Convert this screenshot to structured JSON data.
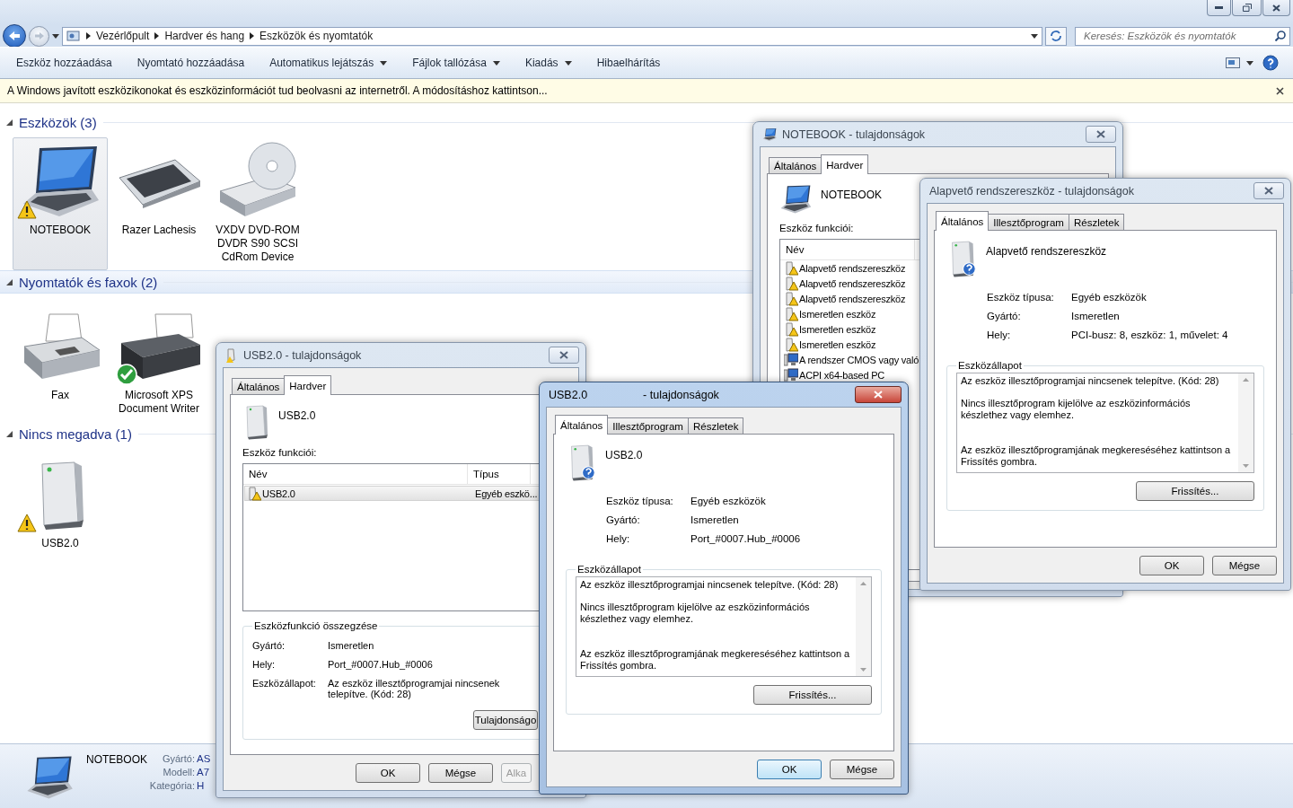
{
  "address_bar": {
    "path": [
      "Vezérlőpult",
      "Hardver és hang",
      "Eszközök és nyomtatók"
    ]
  },
  "search": {
    "placeholder": "Keresés: Eszközök és nyomtatók"
  },
  "toolbar": [
    {
      "label": "Eszköz hozzáadása",
      "dropdown": false
    },
    {
      "label": "Nyomtató hozzáadása",
      "dropdown": false
    },
    {
      "label": "Automatikus lejátszás",
      "dropdown": true
    },
    {
      "label": "Fájlok tallózása",
      "dropdown": true
    },
    {
      "label": "Kiadás",
      "dropdown": true
    },
    {
      "label": "Hibaelhárítás",
      "dropdown": false
    }
  ],
  "info_bar": {
    "text": "A Windows javított eszközikonokat és eszközinformációt tud beolvasni az internetről. A módosításhoz kattintson..."
  },
  "groups": [
    {
      "title": "Eszközök (3)",
      "expanded": true,
      "hovered": false,
      "items": [
        {
          "label": "NOTEBOOK",
          "kind": "laptop",
          "warning": true,
          "default": false,
          "selected": true
        },
        {
          "label": "Razer Lachesis",
          "kind": "keyboard",
          "warning": false,
          "default": false,
          "selected": false
        },
        {
          "label": "VXDV DVD-ROM DVDR S90 SCSI CdRom Device",
          "kind": "drive",
          "warning": false,
          "default": false,
          "selected": false
        }
      ]
    },
    {
      "title": "Nyomtatók és faxok (2)",
      "expanded": true,
      "hovered": true,
      "items": [
        {
          "label": "Fax",
          "kind": "fax",
          "warning": false,
          "default": false,
          "selected": false
        },
        {
          "label": "Microsoft XPS Document Writer",
          "kind": "printer",
          "warning": false,
          "default": true,
          "selected": false
        }
      ]
    },
    {
      "title": "Nincs megadva (1)",
      "expanded": true,
      "hovered": false,
      "items": [
        {
          "label": "USB2.0",
          "kind": "tower",
          "warning": true,
          "default": false,
          "selected": false
        }
      ]
    }
  ],
  "details_pane": {
    "name": "NOTEBOOK",
    "fields": [
      {
        "label": "Gyártó:",
        "value": "AS"
      },
      {
        "label": "Modell:",
        "value": "A7"
      },
      {
        "label": "Kategória:",
        "value": "H"
      }
    ]
  },
  "dialogs": [
    {
      "kind": "computer_hardware",
      "title": "NOTEBOOK - tulajdonságok",
      "active": false,
      "tabs": [
        {
          "label": "Általános",
          "selected": false
        },
        {
          "label": "Hardver",
          "selected": true
        }
      ],
      "device": "NOTEBOOK",
      "functions_label": "Eszköz funkciói:",
      "columns": [
        "Név"
      ],
      "rows": [
        {
          "cells": [
            "Alapvető rendszereszköz"
          ],
          "kind": "warning",
          "selected": false
        },
        {
          "cells": [
            "Alapvető rendszereszköz"
          ],
          "kind": "warning",
          "selected": false
        },
        {
          "cells": [
            "Alapvető rendszereszköz"
          ],
          "kind": "warning",
          "selected": false
        },
        {
          "cells": [
            "Ismeretlen eszköz"
          ],
          "kind": "warning",
          "selected": false
        },
        {
          "cells": [
            "Ismeretlen eszköz"
          ],
          "kind": "warning",
          "selected": false
        },
        {
          "cells": [
            "Ismeretlen eszköz"
          ],
          "kind": "warning",
          "selected": false
        },
        {
          "cells": [
            "A rendszer CMOS vagy való"
          ],
          "kind": "system",
          "selected": false
        },
        {
          "cells": [
            "ACPI x64-based PC"
          ],
          "kind": "system",
          "selected": false
        }
      ]
    },
    {
      "kind": "device_hardware",
      "title": "USB2.0 - tulajdonságok",
      "active": false,
      "tabs": [
        {
          "label": "Általános",
          "selected": false
        },
        {
          "label": "Hardver",
          "selected": true
        }
      ],
      "device": "USB2.0",
      "functions_label": "Eszköz funkciói:",
      "columns": [
        "Név",
        "Típus"
      ],
      "rows": [
        {
          "cells": [
            "USB2.0",
            "Egyéb eszkö..."
          ],
          "kind": "warning",
          "selected": true
        }
      ],
      "summary": {
        "title": "Eszközfunkció összegzése",
        "fields": [
          {
            "label": "Gyártó:",
            "value": "Ismeretlen"
          },
          {
            "label": "Hely:",
            "value": "Port_#0007.Hub_#0006"
          },
          {
            "label": "Eszközállapot:",
            "value": "Az eszköz illesztőprogramjai nincsenek telepítve. (Kód: 28)"
          }
        ]
      },
      "properties_button": "Tulajdonságo",
      "buttons": [
        {
          "label": "OK",
          "default": false,
          "disabled": false
        },
        {
          "label": "Mégse",
          "default": false,
          "disabled": false
        },
        {
          "label": "Alka",
          "default": false,
          "disabled": true
        }
      ]
    },
    {
      "kind": "general",
      "title": "Alapvető rendszereszköz - tulajdonságok",
      "active": false,
      "tabs": [
        {
          "label": "Általános",
          "selected": true
        },
        {
          "label": "Illesztőprogram",
          "selected": false
        },
        {
          "label": "Részletek",
          "selected": false
        }
      ],
      "device": "Alapvető rendszereszköz",
      "properties": [
        {
          "label": "Eszköz típusa:",
          "value": "Egyéb eszközök"
        },
        {
          "label": "Gyártó:",
          "value": "Ismeretlen"
        },
        {
          "label": "Hely:",
          "value": "PCI-busz: 8, eszköz: 1, művelet: 4"
        }
      ],
      "status": {
        "title": "Eszközállapot",
        "paragraphs": [
          "Az eszköz illesztőprogramjai nincsenek telepítve. (Kód: 28)",
          "Nincs illesztőprogram kijelölve az eszközinformációs készlethez vagy elemhez.",
          "Az eszköz illesztőprogramjának megkereséséhez kattintson a Frissítés gombra."
        ],
        "button": "Frissítés..."
      },
      "buttons": [
        {
          "label": "OK",
          "default": false,
          "disabled": false
        },
        {
          "label": "Mégse",
          "default": false,
          "disabled": false
        }
      ]
    },
    {
      "kind": "general",
      "title": "USB2.0",
      "title_suffix": "- tulajdonságok",
      "active": true,
      "tabs": [
        {
          "label": "Általános",
          "selected": true
        },
        {
          "label": "Illesztőprogram",
          "selected": false
        },
        {
          "label": "Részletek",
          "selected": false
        }
      ],
      "device": "USB2.0",
      "properties": [
        {
          "label": "Eszköz típusa:",
          "value": "Egyéb eszközök"
        },
        {
          "label": "Gyártó:",
          "value": "Ismeretlen"
        },
        {
          "label": "Hely:",
          "value": "Port_#0007.Hub_#0006"
        }
      ],
      "status": {
        "title": "Eszközállapot",
        "paragraphs": [
          "Az eszköz illesztőprogramjai nincsenek telepítve. (Kód: 28)",
          "Nincs illesztőprogram kijelölve az eszközinformációs készlethez vagy elemhez.",
          "Az eszköz illesztőprogramjának megkereséséhez kattintson a Frissítés gombra."
        ],
        "button": "Frissítés..."
      },
      "buttons": [
        {
          "label": "OK",
          "default": true,
          "disabled": false
        },
        {
          "label": "Mégse",
          "default": false,
          "disabled": false
        }
      ]
    }
  ]
}
